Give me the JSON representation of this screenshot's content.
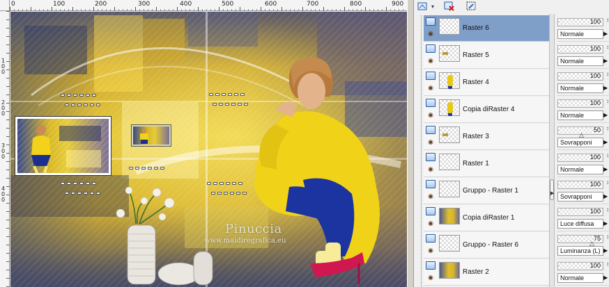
{
  "rulers": {
    "top_labels": [
      "0",
      "100",
      "200",
      "300",
      "400",
      "500",
      "600",
      "700",
      "800",
      "900"
    ],
    "left_labels": [
      "1\n0\n0",
      "2\n0\n0",
      "3\n0\n0",
      "4\n0\n0"
    ]
  },
  "artwork": {
    "watermark_title": "Pinuccia",
    "watermark_url": "www.maidiregrafica.eu"
  },
  "toolbar": {
    "new_layer_icon": "new-layer-icon",
    "delete_layer_icon": "delete-layer-icon",
    "mask_icon": "mask-icon"
  },
  "layers": [
    {
      "name": "Raster 6",
      "opacity": "100",
      "blend": "Normale",
      "selected": true,
      "thumb": "blank"
    },
    {
      "name": "Raster 5",
      "opacity": "100",
      "blend": "Normale",
      "selected": false,
      "thumb": "small"
    },
    {
      "name": "Raster 4",
      "opacity": "100",
      "blend": "Normale",
      "selected": false,
      "thumb": "figure"
    },
    {
      "name": "Copia diRaster 4",
      "opacity": "100",
      "blend": "Normale",
      "selected": false,
      "thumb": "figure"
    },
    {
      "name": "Raster 3",
      "opacity": "50",
      "blend": "Sovrapponi",
      "selected": false,
      "thumb": "small"
    },
    {
      "name": "Raster 1",
      "opacity": "100",
      "blend": "Normale",
      "selected": false,
      "thumb": "blank"
    },
    {
      "name": "Gruppo - Raster 1",
      "opacity": "100",
      "blend": "Sovrapponi",
      "selected": false,
      "thumb": "blank"
    },
    {
      "name": "Copia diRaster 1",
      "opacity": "100",
      "blend": "Luce diffusa",
      "selected": false,
      "thumb": "image"
    },
    {
      "name": "Gruppo - Raster 6",
      "opacity": "75",
      "blend": "Luminanza (L)",
      "selected": false,
      "thumb": "blank"
    },
    {
      "name": "Raster 2",
      "opacity": "100",
      "blend": "Normale",
      "selected": false,
      "thumb": "image"
    }
  ]
}
